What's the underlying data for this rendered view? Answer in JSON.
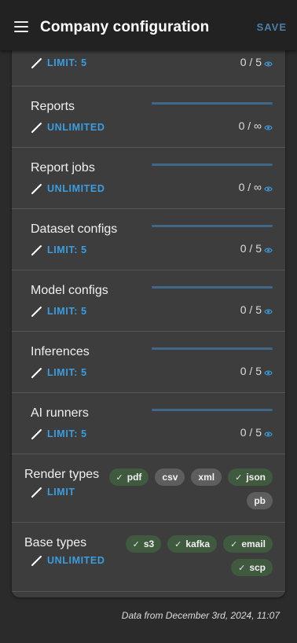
{
  "header": {
    "title": "Company configuration",
    "save_label": "SAVE",
    "menu_icon": "menu-icon"
  },
  "quotas": [
    {
      "label": "",
      "limit": "LIMIT: 5",
      "count": "0 / 5"
    },
    {
      "label": "Reports",
      "limit": "UNLIMITED",
      "count": "0 / ∞"
    },
    {
      "label": "Report jobs",
      "limit": "UNLIMITED",
      "count": "0 / ∞"
    },
    {
      "label": "Dataset configs",
      "limit": "LIMIT: 5",
      "count": "0 / 5"
    },
    {
      "label": "Model configs",
      "limit": "LIMIT: 5",
      "count": "0 / 5"
    },
    {
      "label": "Inferences",
      "limit": "LIMIT: 5",
      "count": "0 / 5"
    },
    {
      "label": "AI runners",
      "limit": "LIMIT: 5",
      "count": "0 / 5"
    }
  ],
  "render_types": {
    "label": "Render types",
    "limit": "LIMIT",
    "chips": [
      {
        "label": "pdf",
        "selected": true
      },
      {
        "label": "csv",
        "selected": false
      },
      {
        "label": "xml",
        "selected": false
      },
      {
        "label": "json",
        "selected": true
      },
      {
        "label": "pb",
        "selected": false
      }
    ]
  },
  "base_types": {
    "label": "Base types",
    "limit": "UNLIMITED",
    "chips": [
      {
        "label": "s3",
        "selected": true
      },
      {
        "label": "kafka",
        "selected": true
      },
      {
        "label": "email",
        "selected": true
      },
      {
        "label": "scp",
        "selected": true
      }
    ]
  },
  "footer": "Data from December 3rd, 2024, 11:07",
  "colors": {
    "accent": "#3b9de0",
    "save": "#4a7fa8",
    "chip_on": "#3f5a3f",
    "chip_off": "#5e5e5e"
  }
}
